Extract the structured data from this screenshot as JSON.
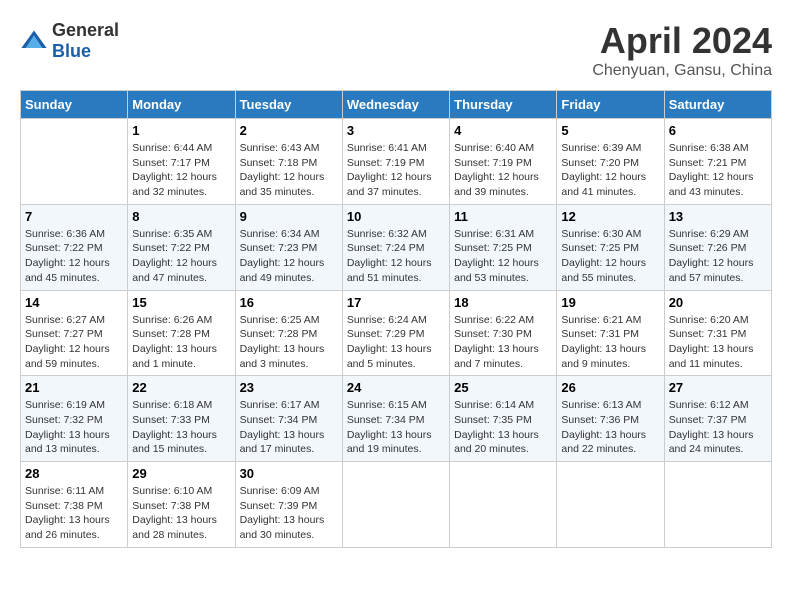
{
  "header": {
    "logo_general": "General",
    "logo_blue": "Blue",
    "month": "April 2024",
    "location": "Chenyuan, Gansu, China"
  },
  "days_of_week": [
    "Sunday",
    "Monday",
    "Tuesday",
    "Wednesday",
    "Thursday",
    "Friday",
    "Saturday"
  ],
  "weeks": [
    [
      {
        "num": "",
        "info": ""
      },
      {
        "num": "1",
        "info": "Sunrise: 6:44 AM\nSunset: 7:17 PM\nDaylight: 12 hours\nand 32 minutes."
      },
      {
        "num": "2",
        "info": "Sunrise: 6:43 AM\nSunset: 7:18 PM\nDaylight: 12 hours\nand 35 minutes."
      },
      {
        "num": "3",
        "info": "Sunrise: 6:41 AM\nSunset: 7:19 PM\nDaylight: 12 hours\nand 37 minutes."
      },
      {
        "num": "4",
        "info": "Sunrise: 6:40 AM\nSunset: 7:19 PM\nDaylight: 12 hours\nand 39 minutes."
      },
      {
        "num": "5",
        "info": "Sunrise: 6:39 AM\nSunset: 7:20 PM\nDaylight: 12 hours\nand 41 minutes."
      },
      {
        "num": "6",
        "info": "Sunrise: 6:38 AM\nSunset: 7:21 PM\nDaylight: 12 hours\nand 43 minutes."
      }
    ],
    [
      {
        "num": "7",
        "info": "Sunrise: 6:36 AM\nSunset: 7:22 PM\nDaylight: 12 hours\nand 45 minutes."
      },
      {
        "num": "8",
        "info": "Sunrise: 6:35 AM\nSunset: 7:22 PM\nDaylight: 12 hours\nand 47 minutes."
      },
      {
        "num": "9",
        "info": "Sunrise: 6:34 AM\nSunset: 7:23 PM\nDaylight: 12 hours\nand 49 minutes."
      },
      {
        "num": "10",
        "info": "Sunrise: 6:32 AM\nSunset: 7:24 PM\nDaylight: 12 hours\nand 51 minutes."
      },
      {
        "num": "11",
        "info": "Sunrise: 6:31 AM\nSunset: 7:25 PM\nDaylight: 12 hours\nand 53 minutes."
      },
      {
        "num": "12",
        "info": "Sunrise: 6:30 AM\nSunset: 7:25 PM\nDaylight: 12 hours\nand 55 minutes."
      },
      {
        "num": "13",
        "info": "Sunrise: 6:29 AM\nSunset: 7:26 PM\nDaylight: 12 hours\nand 57 minutes."
      }
    ],
    [
      {
        "num": "14",
        "info": "Sunrise: 6:27 AM\nSunset: 7:27 PM\nDaylight: 12 hours\nand 59 minutes."
      },
      {
        "num": "15",
        "info": "Sunrise: 6:26 AM\nSunset: 7:28 PM\nDaylight: 13 hours\nand 1 minute."
      },
      {
        "num": "16",
        "info": "Sunrise: 6:25 AM\nSunset: 7:28 PM\nDaylight: 13 hours\nand 3 minutes."
      },
      {
        "num": "17",
        "info": "Sunrise: 6:24 AM\nSunset: 7:29 PM\nDaylight: 13 hours\nand 5 minutes."
      },
      {
        "num": "18",
        "info": "Sunrise: 6:22 AM\nSunset: 7:30 PM\nDaylight: 13 hours\nand 7 minutes."
      },
      {
        "num": "19",
        "info": "Sunrise: 6:21 AM\nSunset: 7:31 PM\nDaylight: 13 hours\nand 9 minutes."
      },
      {
        "num": "20",
        "info": "Sunrise: 6:20 AM\nSunset: 7:31 PM\nDaylight: 13 hours\nand 11 minutes."
      }
    ],
    [
      {
        "num": "21",
        "info": "Sunrise: 6:19 AM\nSunset: 7:32 PM\nDaylight: 13 hours\nand 13 minutes."
      },
      {
        "num": "22",
        "info": "Sunrise: 6:18 AM\nSunset: 7:33 PM\nDaylight: 13 hours\nand 15 minutes."
      },
      {
        "num": "23",
        "info": "Sunrise: 6:17 AM\nSunset: 7:34 PM\nDaylight: 13 hours\nand 17 minutes."
      },
      {
        "num": "24",
        "info": "Sunrise: 6:15 AM\nSunset: 7:34 PM\nDaylight: 13 hours\nand 19 minutes."
      },
      {
        "num": "25",
        "info": "Sunrise: 6:14 AM\nSunset: 7:35 PM\nDaylight: 13 hours\nand 20 minutes."
      },
      {
        "num": "26",
        "info": "Sunrise: 6:13 AM\nSunset: 7:36 PM\nDaylight: 13 hours\nand 22 minutes."
      },
      {
        "num": "27",
        "info": "Sunrise: 6:12 AM\nSunset: 7:37 PM\nDaylight: 13 hours\nand 24 minutes."
      }
    ],
    [
      {
        "num": "28",
        "info": "Sunrise: 6:11 AM\nSunset: 7:38 PM\nDaylight: 13 hours\nand 26 minutes."
      },
      {
        "num": "29",
        "info": "Sunrise: 6:10 AM\nSunset: 7:38 PM\nDaylight: 13 hours\nand 28 minutes."
      },
      {
        "num": "30",
        "info": "Sunrise: 6:09 AM\nSunset: 7:39 PM\nDaylight: 13 hours\nand 30 minutes."
      },
      {
        "num": "",
        "info": ""
      },
      {
        "num": "",
        "info": ""
      },
      {
        "num": "",
        "info": ""
      },
      {
        "num": "",
        "info": ""
      }
    ]
  ]
}
